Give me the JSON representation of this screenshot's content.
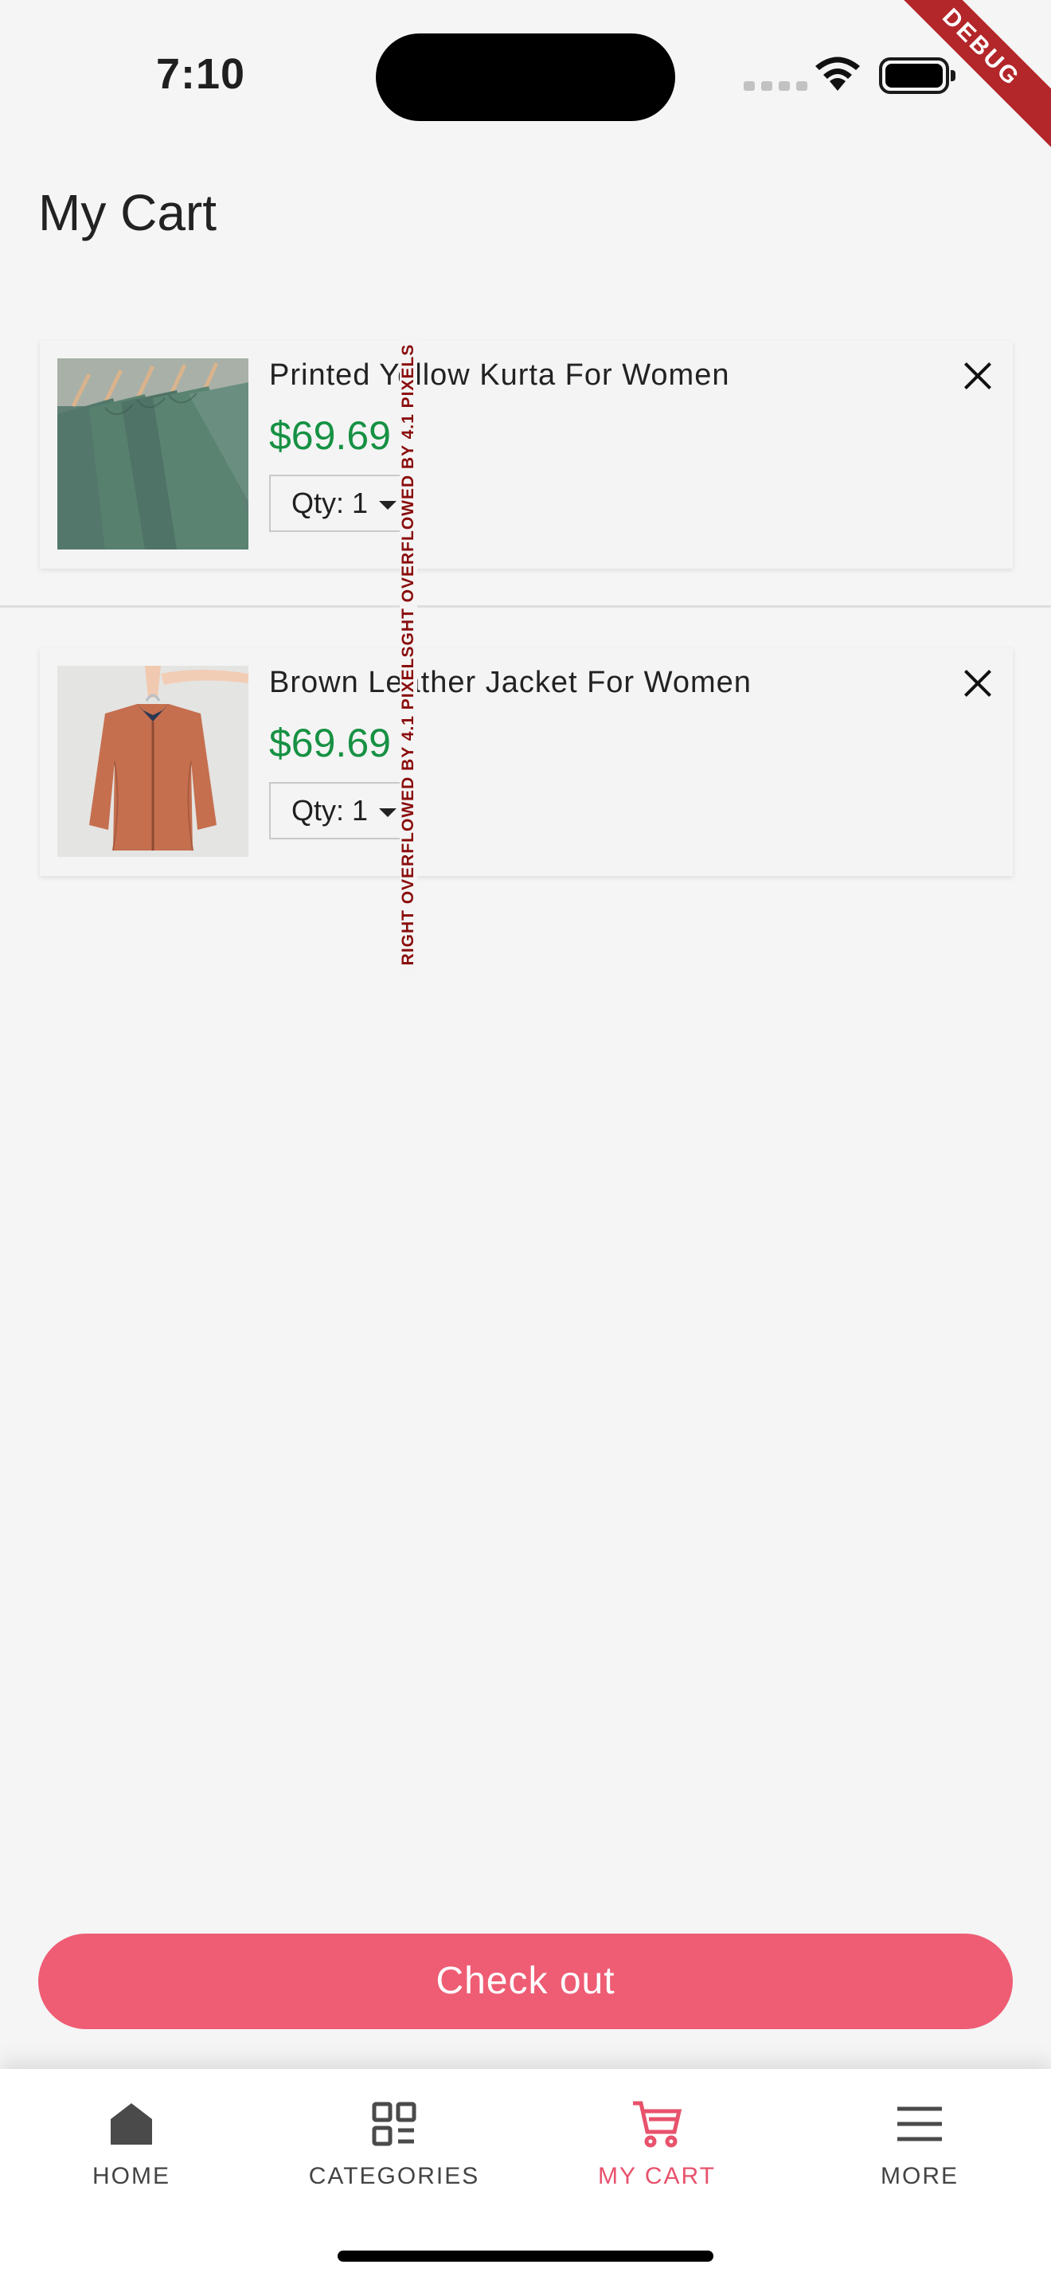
{
  "status_bar": {
    "time": "7:10"
  },
  "debug_banner": "DEBUG",
  "page": {
    "title": "My Cart"
  },
  "cart": {
    "items": [
      {
        "name": "Printed Yellow Kurta For Women",
        "price": "$69.69",
        "qty_label": "Qty: 1",
        "image": "green-tshirts-on-hangers"
      },
      {
        "name": "Brown Leather Jacket For Women",
        "price": "$69.69",
        "qty_label": "Qty: 1",
        "image": "brown-jacket-on-hanger"
      }
    ]
  },
  "overflow_warning": "RIGHT OVERFLOWED BY 4.1 PIXELSGHT OVERFLOWED BY 4.1 PIXELS",
  "checkout_label": "Check out",
  "bottom_nav": {
    "items": [
      {
        "label": "HOME",
        "icon": "home-icon"
      },
      {
        "label": "CATEGORIES",
        "icon": "categories-icon"
      },
      {
        "label": "MY CART",
        "icon": "cart-icon",
        "active": true
      },
      {
        "label": "MORE",
        "icon": "menu-icon"
      }
    ]
  },
  "colors": {
    "accent": "#ee5d74",
    "price": "#169143",
    "background": "#f5f5f5"
  }
}
